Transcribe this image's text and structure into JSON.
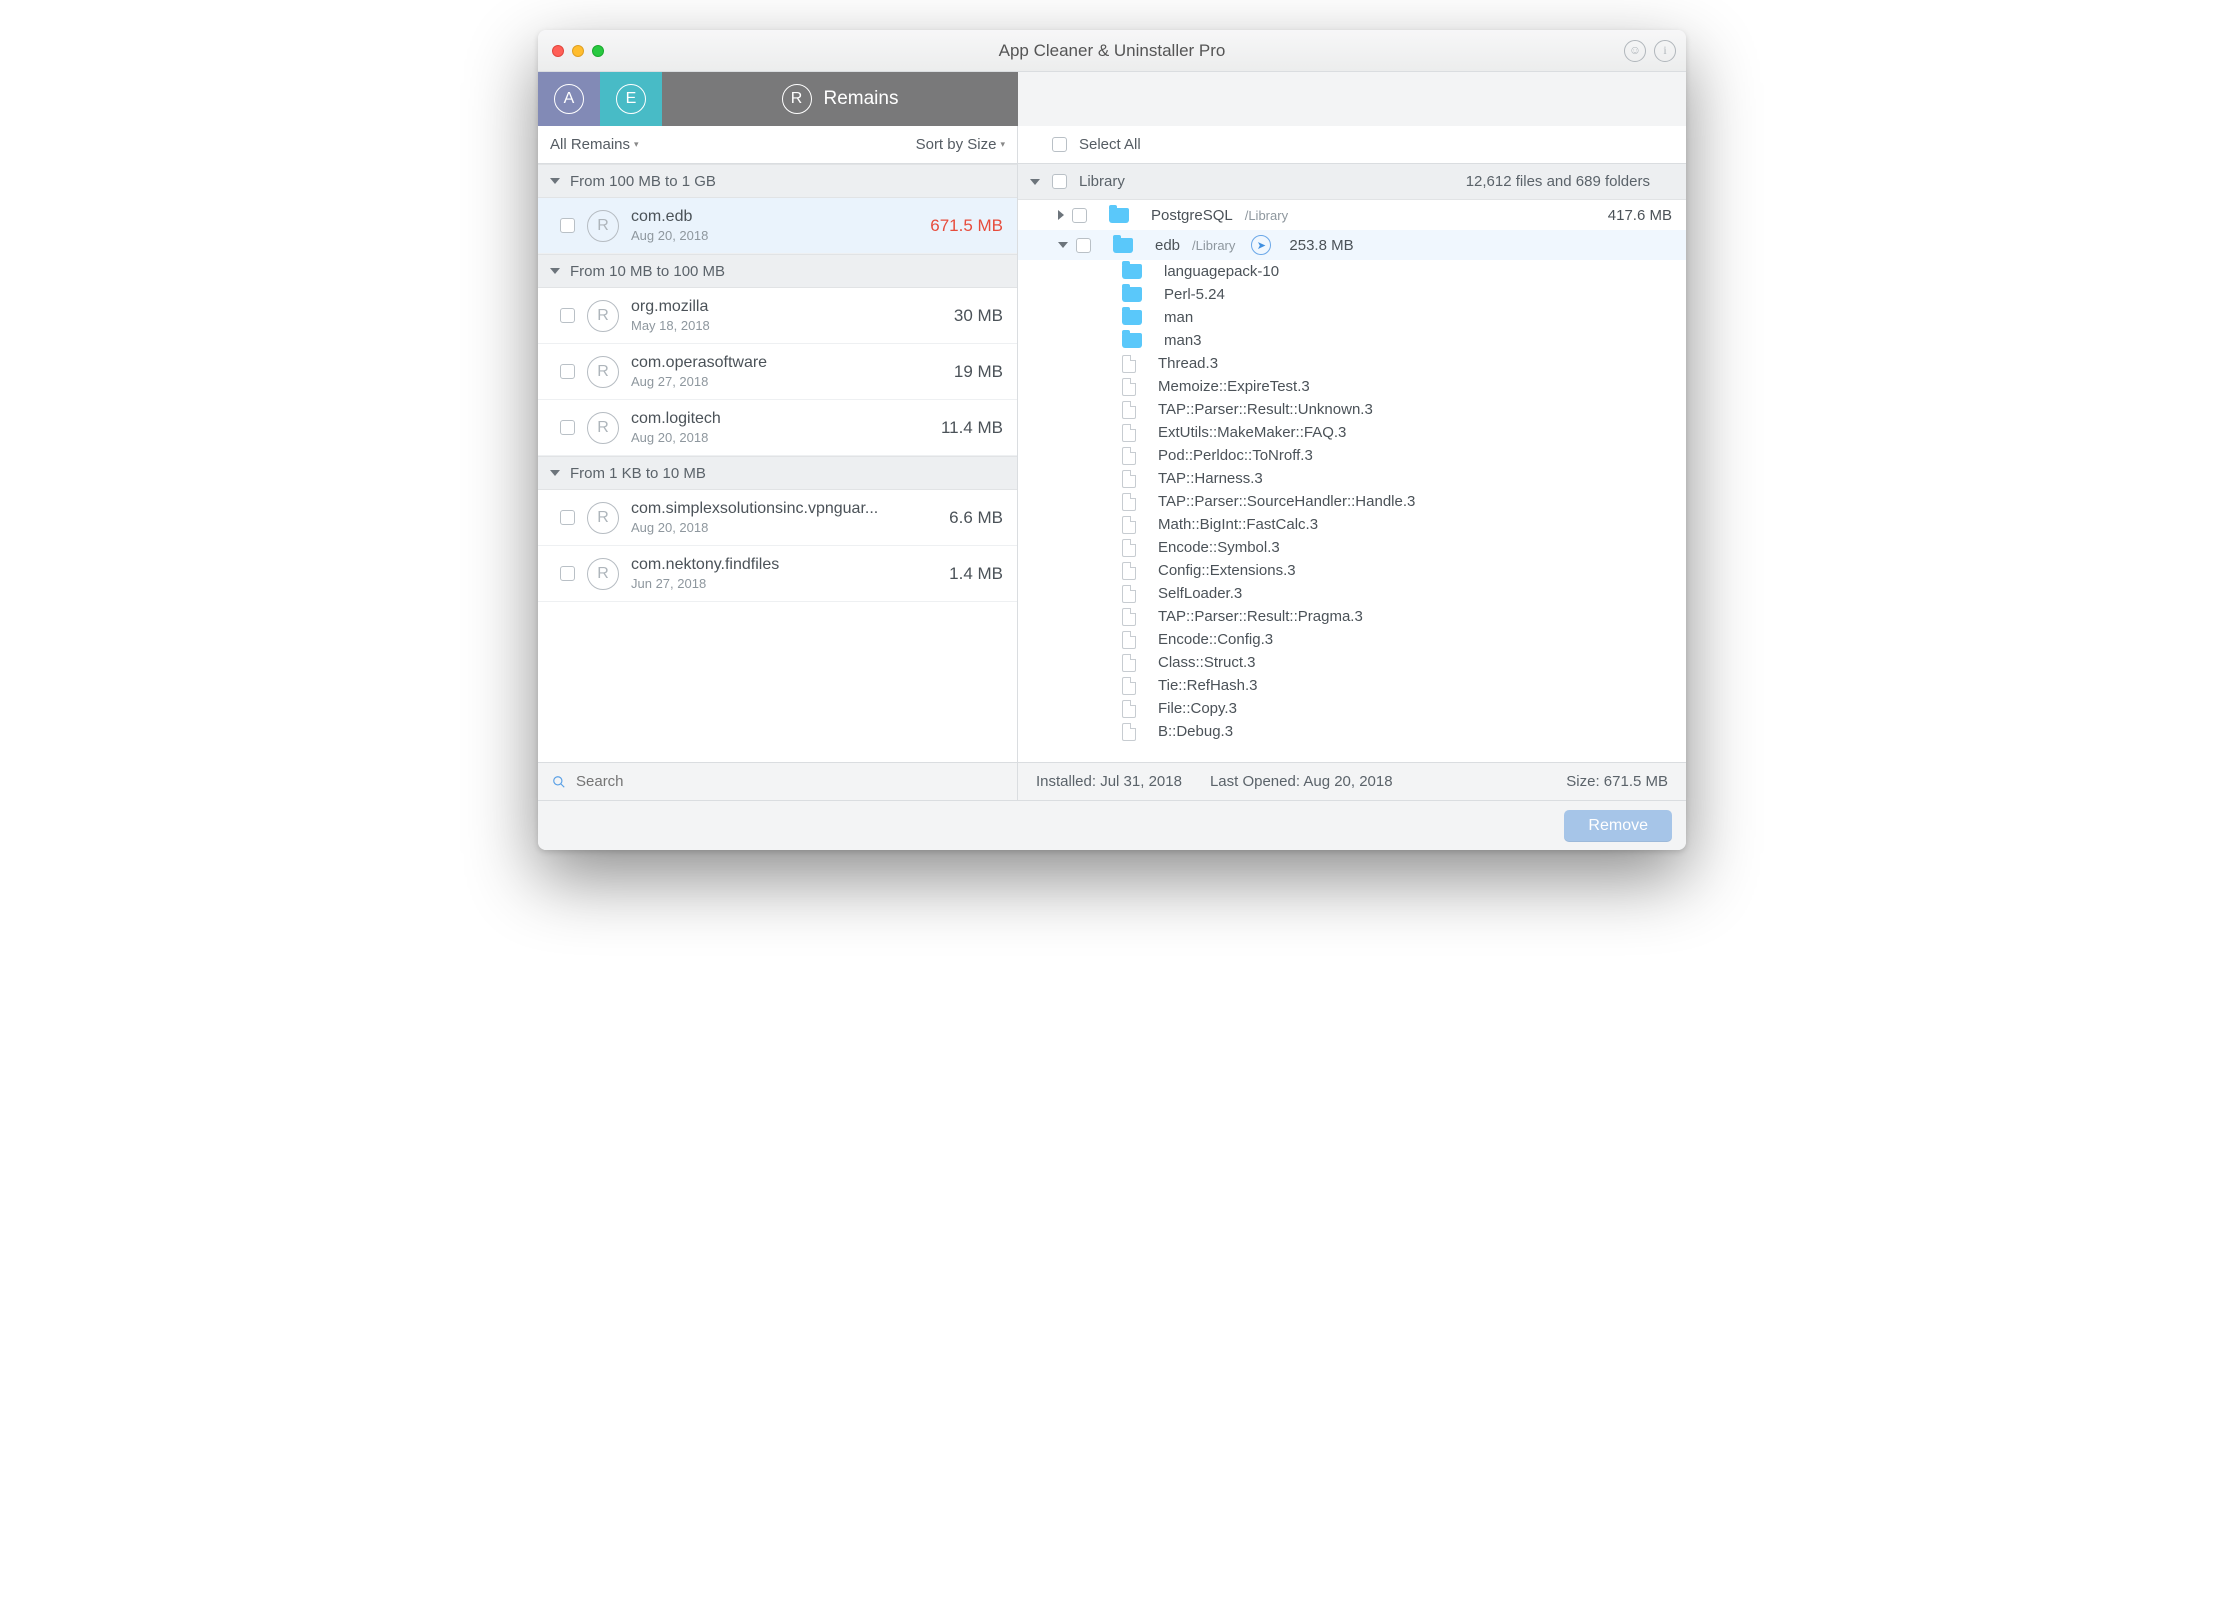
{
  "window": {
    "title": "App Cleaner & Uninstaller Pro"
  },
  "tabs": {
    "remains_label": "Remains"
  },
  "filter": {
    "all_label": "All Remains",
    "sort_label": "Sort by Size"
  },
  "sections": {
    "g1": "From 100 MB to 1 GB",
    "g2": "From 10 MB to 100 MB",
    "g3": "From 1 KB to 10 MB"
  },
  "remains": {
    "r1": {
      "name": "com.edb",
      "date": "Aug 20, 2018",
      "size": "671.5 MB"
    },
    "r2": {
      "name": "org.mozilla",
      "date": "May 18, 2018",
      "size": "30 MB"
    },
    "r3": {
      "name": "com.operasoftware",
      "date": "Aug 27, 2018",
      "size": "19 MB"
    },
    "r4": {
      "name": "com.logitech",
      "date": "Aug 20, 2018",
      "size": "11.4 MB"
    },
    "r5": {
      "name": "com.simplexsolutionsinc.vpnguar...",
      "date": "Aug 20, 2018",
      "size": "6.6 MB"
    },
    "r6": {
      "name": "com.nektony.findfiles",
      "date": "Jun 27, 2018",
      "size": "1.4 MB"
    }
  },
  "search": {
    "placeholder": "Search"
  },
  "right": {
    "select_all": "Select All",
    "lib_label": "Library",
    "lib_meta": "12,612 files and 689 folders",
    "n1": {
      "name": "PostgreSQL",
      "path": "/Library",
      "size": "417.6 MB"
    },
    "n2": {
      "name": "edb",
      "path": "/Library",
      "size": "253.8 MB"
    },
    "children": [
      "languagepack-10",
      "Perl-5.24",
      "man",
      "man3",
      "Thread.3",
      "Memoize::ExpireTest.3",
      "TAP::Parser::Result::Unknown.3",
      "ExtUtils::MakeMaker::FAQ.3",
      "Pod::Perldoc::ToNroff.3",
      "TAP::Harness.3",
      "TAP::Parser::SourceHandler::Handle.3",
      "Math::BigInt::FastCalc.3",
      "Encode::Symbol.3",
      "Config::Extensions.3",
      "SelfLoader.3",
      "TAP::Parser::Result::Pragma.3",
      "Encode::Config.3",
      "Class::Struct.3",
      "Tie::RefHash.3",
      "File::Copy.3",
      "B::Debug.3"
    ],
    "child_is_folder": [
      true,
      true,
      true,
      true,
      false,
      false,
      false,
      false,
      false,
      false,
      false,
      false,
      false,
      false,
      false,
      false,
      false,
      false,
      false,
      false,
      false
    ]
  },
  "info": {
    "installed": "Installed: Jul 31, 2018",
    "opened": "Last Opened: Aug 20, 2018",
    "size": "Size: 671.5 MB"
  },
  "footer": {
    "remove": "Remove"
  }
}
